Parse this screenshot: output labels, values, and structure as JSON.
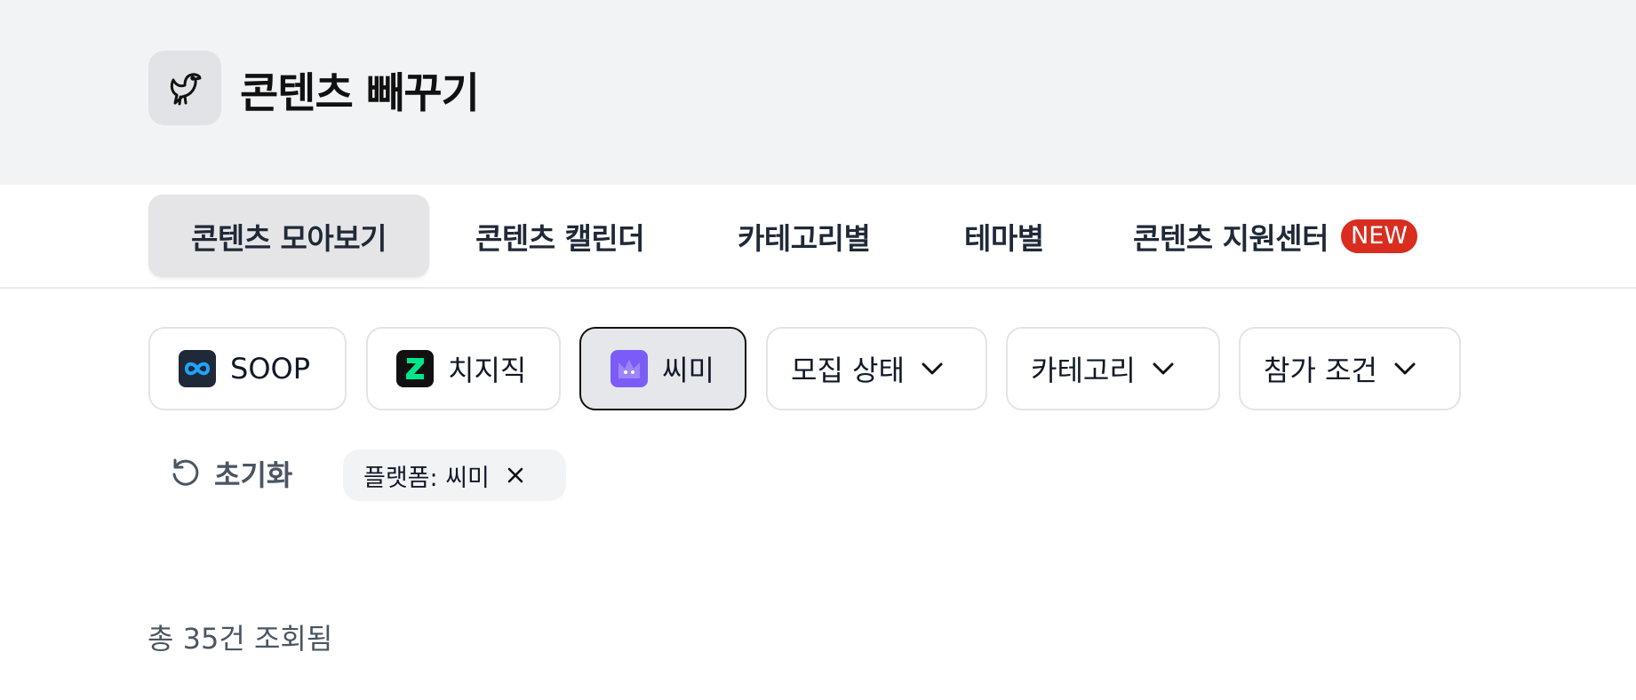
{
  "header": {
    "logo_icon": "bird-icon",
    "title": "콘텐츠 빼꾸기"
  },
  "nav": {
    "tabs": [
      {
        "label": "콘텐츠 모아보기",
        "active": true
      },
      {
        "label": "콘텐츠 캘린더",
        "active": false
      },
      {
        "label": "카테고리별",
        "active": false
      },
      {
        "label": "테마별",
        "active": false
      },
      {
        "label": "콘텐츠 지원센터",
        "active": false,
        "badge": "NEW"
      }
    ]
  },
  "filters": {
    "platforms": [
      {
        "label": "SOOP",
        "icon": "soop-icon",
        "selected": false,
        "color": "#1f2937"
      },
      {
        "label": "치지직",
        "icon": "chzzk-icon",
        "selected": false,
        "color": "#111111"
      },
      {
        "label": "씨미",
        "icon": "cime-icon",
        "selected": true,
        "color": "#7c5cf6"
      }
    ],
    "dropdowns": [
      {
        "label": "모집 상태",
        "icon": "chevron-down-icon"
      },
      {
        "label": "카테고리",
        "icon": "chevron-down-icon"
      },
      {
        "label": "참가 조건",
        "icon": "chevron-down-icon"
      }
    ]
  },
  "active_filters": {
    "reset_label": "초기화",
    "chips": [
      {
        "label": "플랫폼: 씨미"
      }
    ]
  },
  "results": {
    "count_text": "총 35건 조회됨"
  },
  "colors": {
    "header_bg": "#f2f3f5",
    "new_badge": "#d92d20",
    "accent_purple": "#7c5cf6",
    "chzzk_green": "#00e68a",
    "soop_blue": "#1fa3ff"
  }
}
